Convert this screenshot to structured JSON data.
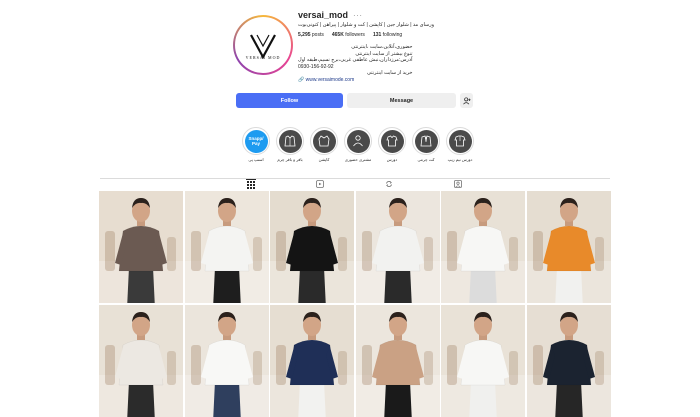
{
  "profile": {
    "username": "versai_mod",
    "more": "···",
    "category_line": "ورسای مد | شلوار جین | کاپشن | کت و شلوار | پیراهن | کتونی‌بوت",
    "avatar_text": "VERSAI MOD",
    "stats": {
      "posts_value": "5,295",
      "posts_label": "posts",
      "followers_value": "465K",
      "followers_label": "followers",
      "following_value": "131",
      "following_label": "following"
    },
    "bio": [
      "حضوری،آنلاین،سایت ،اینترنتی",
      "تنوع بیشتر از سایت اینترنتی",
      "آدرس:مرزداران،نبش عاطفی غربی،برج نسیم،طبقه اول",
      "0930-156-92-92",
      "خرید از سایت اینترنتی"
    ],
    "link": "www.versaimode.com"
  },
  "actions": {
    "follow_label": "Follow",
    "message_label": "Message",
    "adduser_icon": "add-user-icon"
  },
  "highlights": [
    {
      "label": "اسنپ پی",
      "inner": "Snapp/ Pay",
      "icon": "snapp-pay-icon"
    },
    {
      "label": "بافر و بافر چرم",
      "icon": "jacket-icon"
    },
    {
      "label": "کاپشن",
      "icon": "coat-icon"
    },
    {
      "label": "مشتری حضوری",
      "icon": "customer-icon"
    },
    {
      "label": "دورس",
      "icon": "shirt-icon"
    },
    {
      "label": "کت چرمی",
      "icon": "leather-jacket-icon"
    },
    {
      "label": "دورس نیم زیپ",
      "icon": "halfzip-icon"
    }
  ],
  "tabs": [
    {
      "name": "posts",
      "icon": "grid-icon",
      "active": true
    },
    {
      "name": "reels",
      "icon": "reels-icon",
      "active": false
    },
    {
      "name": "reposts",
      "icon": "repost-icon",
      "active": false
    },
    {
      "name": "tagged",
      "icon": "tagged-icon",
      "active": false
    }
  ],
  "posts": [
    {
      "shirt": "#6b5a52",
      "pants": "#3a3a3a",
      "bg": "#e7ddd0",
      "badge": "pin-icon"
    },
    {
      "shirt": "#f4f4f2",
      "pants": "#1e1e1e",
      "bg": "#ede6dc",
      "badge": "pin-icon"
    },
    {
      "shirt": "#141414",
      "pants": "#2a2a2a",
      "bg": "#e4dccf",
      "badge": "pin-icon"
    },
    {
      "shirt": "#f2f2f0",
      "pants": "#2a2a2a",
      "bg": "#ece6de",
      "badge": "reel-icon"
    },
    {
      "shirt": "#f7f7f5",
      "pants": "#dcdcdc",
      "bg": "#e8e1d6",
      "badge": "reel-icon"
    },
    {
      "shirt": "#e88a2a",
      "pants": "#f1f1ef",
      "bg": "#e5ddd1",
      "badge": "reel-icon"
    },
    {
      "shirt": "#ece8e2",
      "pants": "#2b2b2b",
      "bg": "#e8e1d6",
      "badge": "reel-icon"
    },
    {
      "shirt": "#f8f8f6",
      "pants": "#2f3f5e",
      "bg": "#ebe5dc",
      "badge": "reel-icon"
    },
    {
      "shirt": "#1f2f57",
      "pants": "#f2f2f0",
      "bg": "#e6ded2",
      "badge": "reel-icon"
    },
    {
      "shirt": "#caa184",
      "pants": "#1a1a1a",
      "bg": "#ece6dd",
      "badge": "reel-icon"
    },
    {
      "shirt": "#f7f7f5",
      "pants": "#f0f0ee",
      "bg": "#e9e2d7",
      "badge": "reel-icon"
    },
    {
      "shirt": "#1b2330",
      "pants": "#262626",
      "bg": "#e6ded3",
      "badge": "reel-icon"
    }
  ]
}
